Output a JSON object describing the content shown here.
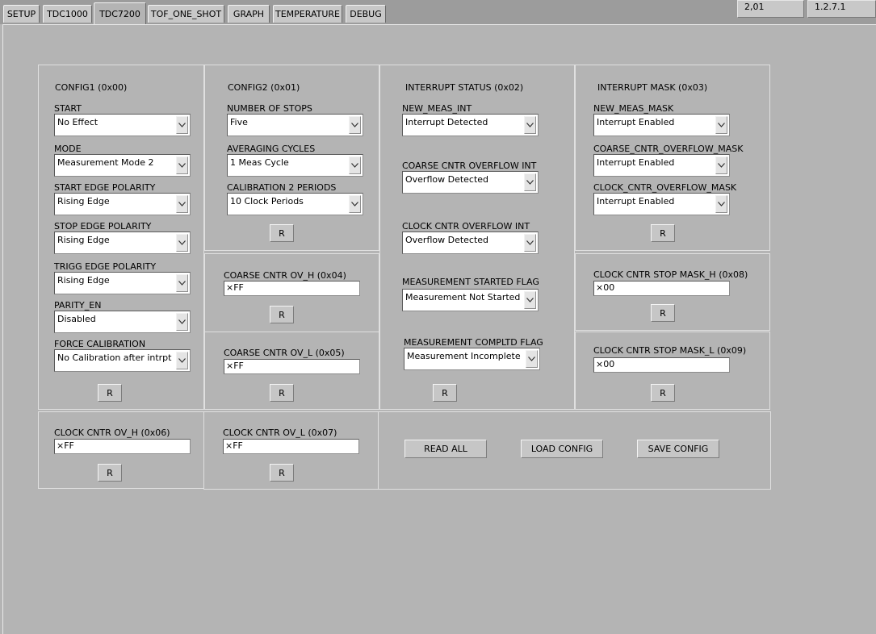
{
  "tabs": [
    "SETUP",
    "TDC1000",
    "TDC7200",
    "TOF_ONE_SHOT",
    "GRAPH",
    "TEMPERATURE",
    "DEBUG"
  ],
  "active_tab": "TDC7200",
  "versions": {
    "left": "2,01",
    "right": "1.2.7.1"
  },
  "config1": {
    "title": "CONFIG1 (0x00)",
    "fields": [
      {
        "label": "START",
        "value": "No Effect"
      },
      {
        "label": "MODE",
        "value": "Measurement Mode 2"
      },
      {
        "label": "START EDGE POLARITY",
        "value": "Rising Edge"
      },
      {
        "label": "STOP EDGE POLARITY",
        "value": "Rising Edge"
      },
      {
        "label": "TRIGG EDGE POLARITY",
        "value": "Rising Edge"
      },
      {
        "label": "PARITY_EN",
        "value": "Disabled"
      },
      {
        "label": "FORCE CALIBRATION",
        "value": "No Calibration after intrpt"
      }
    ],
    "read_label": "R"
  },
  "config2": {
    "title": "CONFIG2 (0x01)",
    "fields": [
      {
        "label": "NUMBER OF STOPS",
        "value": "Five"
      },
      {
        "label": "AVERAGING CYCLES",
        "value": "1 Meas Cycle"
      },
      {
        "label": "CALIBRATION 2 PERIODS",
        "value": "10 Clock Periods"
      }
    ],
    "read_label": "R"
  },
  "interrupt_status": {
    "title": "INTERRUPT STATUS (0x02)",
    "fields": [
      {
        "label": "NEW_MEAS_INT",
        "value": "Interrupt Detected"
      },
      {
        "label": "COARSE CNTR OVERFLOW INT",
        "value": "Overflow Detected"
      },
      {
        "label": "CLOCK CNTR OVERFLOW INT",
        "value": "Overflow Detected"
      },
      {
        "label": "MEASUREMENT STARTED FLAG",
        "value": "Measurement Not Started"
      },
      {
        "label": "MEASUREMENT COMPLTD FLAG",
        "value": "Measurement Incomplete"
      }
    ],
    "read_label": "R"
  },
  "interrupt_mask": {
    "title": "INTERRUPT MASK (0x03)",
    "fields": [
      {
        "label": "NEW_MEAS_MASK",
        "value": "Interrupt Enabled"
      },
      {
        "label": "COARSE_CNTR_OVERFLOW_MASK",
        "value": "Interrupt Enabled"
      },
      {
        "label": "CLOCK_CNTR_OVERFLOW_MASK",
        "value": "Interrupt Enabled"
      }
    ],
    "read_label": "R"
  },
  "coarse_cntr_ov_h": {
    "label": "COARSE CNTR OV_H (0x04)",
    "value": "×FF",
    "read_label": "R"
  },
  "coarse_cntr_ov_l": {
    "label": "COARSE CNTR OV_L (0x05)",
    "value": "×FF",
    "read_label": "R"
  },
  "clock_cntr_ov_h": {
    "label": "CLOCK CNTR OV_H (0x06)",
    "value": "×FF",
    "read_label": "R"
  },
  "clock_cntr_ov_l": {
    "label": "CLOCK CNTR OV_L (0x07)",
    "value": "×FF",
    "read_label": "R"
  },
  "clock_cntr_stop_mask_h": {
    "label": "CLOCK CNTR STOP MASK_H (0x08)",
    "value": "×00",
    "read_label": "R"
  },
  "clock_cntr_stop_mask_l": {
    "label": "CLOCK CNTR STOP MASK_L (0x09)",
    "value": "×00",
    "read_label": "R"
  },
  "actions": {
    "read_all": "READ ALL",
    "load_config": "LOAD CONFIG",
    "save_config": "SAVE CONFIG"
  }
}
